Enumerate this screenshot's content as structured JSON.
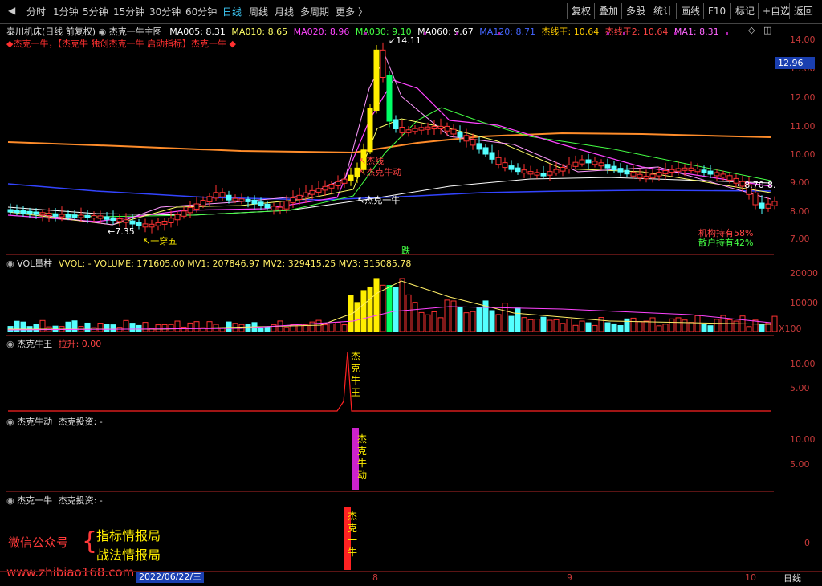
{
  "toolbar": {
    "tabs": [
      "分时",
      "1分钟",
      "5分钟",
      "15分钟",
      "30分钟",
      "60分钟",
      "日线",
      "周线",
      "月线",
      "多周期",
      "更多"
    ],
    "active_tab": "日线",
    "right_buttons": [
      "复权",
      "叠加",
      "多股",
      "统计",
      "画线",
      "F10",
      "标记",
      "+自选",
      "返回"
    ]
  },
  "main_panel": {
    "stock": "泰川机床(日线 前复权)",
    "indicator": "杰克一牛主图",
    "ma": [
      {
        "label": "MA005: 8.31",
        "color": "#ffffff"
      },
      {
        "label": "MA010: 8.65",
        "color": "#ffff66"
      },
      {
        "label": "MA020: 8.96",
        "color": "#ff44ff"
      },
      {
        "label": "MA030: 9.10",
        "color": "#44ff44"
      },
      {
        "label": "MA060: 9.67",
        "color": "#ffffff"
      },
      {
        "label": "MA120: 8.71",
        "color": "#4466ff"
      },
      {
        "label": "杰线王: 10.64",
        "color": "#ffcc00"
      },
      {
        "label": "杰线王2: 10.64",
        "color": "#ff4444"
      },
      {
        "label": "MA1: 8.31",
        "color": "#ff66ff"
      }
    ],
    "banner": "◆杰克一牛，【杰克牛 独创杰克一牛 启动指标】杰克一牛 ◆",
    "annotations": {
      "high": "14.11",
      "low": "7.35",
      "cross": "一穿五",
      "low_right": "8.70",
      "trend": "8.",
      "fall": "跌",
      "bull_line": "杰克一牛",
      "jie_line": "杰线",
      "bull_move": "杰克牛动"
    },
    "holdings": [
      "机构持有58%",
      "散户持有42%"
    ],
    "price_label": "12.96",
    "y_ticks": [
      "14.00",
      "13.00",
      "12.00",
      "11.00",
      "10.00",
      "9.00",
      "8.00",
      "7.00"
    ]
  },
  "volume_panel": {
    "title": "VOL量柱",
    "values": "VVOL: -  VOLUME: 171605.00  MV1: 207846.97  MV2: 329415.25  MV3: 315085.78",
    "y_ticks": [
      "20000",
      "10000",
      "X100"
    ]
  },
  "panel_a": {
    "title": "杰克牛王",
    "sub": "拉升: 0.00",
    "label": "杰克牛王",
    "y_ticks": [
      "10.00",
      "5.00"
    ]
  },
  "panel_b": {
    "title": "杰克牛动",
    "sub": "杰克投资: -",
    "label": "杰克牛动",
    "y_ticks": [
      "10.00",
      "5.00"
    ]
  },
  "panel_c": {
    "title": "杰克一牛",
    "sub": "杰克投资: -",
    "label": "杰克一牛",
    "y_ticks": [
      "0"
    ]
  },
  "watermark": {
    "wechat": "微信公众号",
    "brand1": "指标情报局",
    "brand2": "战法情报局",
    "url": "www.zhibiao168.com"
  },
  "bottom": {
    "date": "2022/06/22/三",
    "m8": "8",
    "m9": "9",
    "m10": "10",
    "period": "日线"
  },
  "colors": {
    "up": "#ff3232",
    "down": "#54ffff",
    "yellow": "#ffee00",
    "green": "#00ff66",
    "axis": "#c83a3a",
    "magenta": "#cc22cc"
  }
}
